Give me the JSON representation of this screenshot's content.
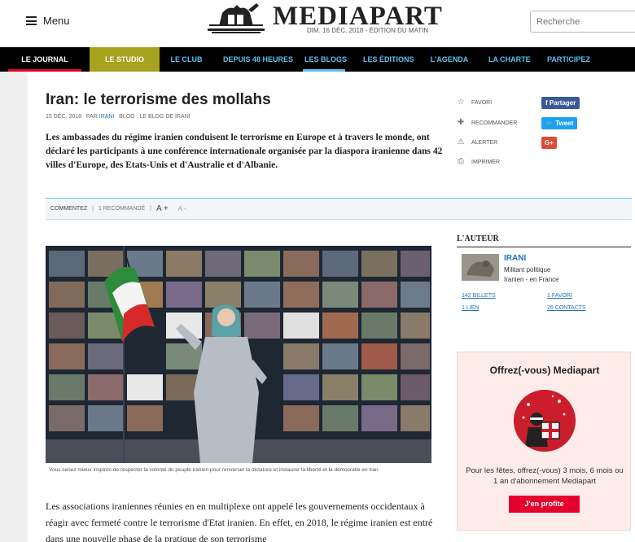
{
  "header": {
    "menu_label": "Menu",
    "logo_text": "MEDIAPART",
    "edition": "DIM. 16 DÉC. 2018 - ÉDITION DU MATIN",
    "search_placeholder": "Recherche"
  },
  "nav": {
    "items": [
      {
        "label": "LE JOURNAL"
      },
      {
        "label": "LE STUDIO"
      },
      {
        "label": "LE CLUB"
      },
      {
        "label": "DEPUIS 48 HEURES"
      },
      {
        "label": "LES BLOGS"
      },
      {
        "label": "LES ÉDITIONS"
      },
      {
        "label": "L'AGENDA"
      },
      {
        "label": "LA CHARTE"
      },
      {
        "label": "PARTICIPEZ"
      }
    ]
  },
  "article": {
    "title": "Iran: le terrorisme des mollahs",
    "date": "15 DÉC. 2018",
    "par": "PAR",
    "author": "IRANI",
    "blog": "BLOG : LE BLOG DE IRANI",
    "chapo": "Les ambassades du régime iranien conduisent le terrorisme en Europe et à travers le monde, ont déclaré les participants à une conférence internationale  organisée par la diaspora iranienne dans 42 villes d'Europe, des Etats-Unis et d'Australie et d'Albanie.",
    "caption": "Vous seriez mieux inspirés de respecter la volonté du peuple iranien pour renverser la dictature et instaurer la liberté et la démocratie en Iran.",
    "body": "Les associations iraniennes réunies en en multiplexe ont appelé les gouvernements occidentaux à réagir avec fermeté contre le terrorisme d'Etat iranien. En effet, en 2018, le régime iranien est entré dans une nouvelle phase de la pratique de son terrorisme"
  },
  "actions": {
    "favori": "FAVORI",
    "recommander": "RECOMMANDER",
    "alerter": "ALERTER",
    "imprimer": "IMPRIMER",
    "partager": "Partager",
    "tweet": "Tweet",
    "gplus": "G+"
  },
  "toolbar": {
    "commentez": "COMMENTEZ",
    "recommande": "1 RECOMMANDÉ",
    "font_plus": "A +",
    "font_minus": "A -"
  },
  "sidebar": {
    "author_title": "L'AUTEUR",
    "author_name": "IRANI",
    "author_desc_1": "Militant politique",
    "author_desc_2": "Iranien - en France",
    "billets": "142 BILLETS",
    "favori": "1 FAVORI",
    "lien": "1 LIEN",
    "contacts": "26 CONTACTS",
    "promo_title": "Offrez(-vous) Mediapart",
    "promo_text": "Pour les fêtes, offrez(-vous) 3 mois, 6 mois ou 1 an d'abonnement Mediapart",
    "promo_button": "J'en profite"
  },
  "colors": {
    "nav_bg": "#000000",
    "studio": "#a8a31f",
    "blue_link": "#5bc0f2",
    "red": "#e5002d"
  }
}
